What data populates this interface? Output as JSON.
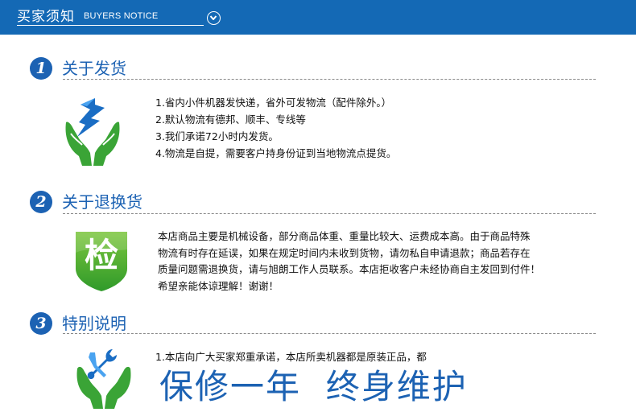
{
  "header": {
    "title_cn": "买家须知",
    "title_en": "BUYERS NOTICE"
  },
  "sections": [
    {
      "number": "1",
      "title": "关于发货",
      "icon": "hands-lightning-icon",
      "lines": [
        "1.省内小件机器发快递，省外可发物流（配件除外。）",
        "2.默认物流有德邦、顺丰、专线等",
        "3.我们承诺72小时内发货。",
        "4.物流是自提，需要客户持身份证到当地物流点提货。"
      ]
    },
    {
      "number": "2",
      "title": "关于退换货",
      "icon": "inspection-shield-icon",
      "icon_text": "检",
      "paragraph_lines": [
        "本店商品主要是机械设备，部分商品体重、重量比较大、运费成本高。由于商品特殊",
        "物流有时存在延误，如果在规定时间内未收到货物，请勿私自申请退款；商品若存在",
        "质量问题需退换货，请与旭朗工作人员联系。本店拒收客户未经协商自主发回到付件！",
        "希望亲能体谅理解！谢谢！"
      ]
    },
    {
      "number": "3",
      "title": "特别说明",
      "icon": "hands-wrench-icon",
      "lines": [
        "1.本店向广大买家郑重承诺，本店所卖机器都是原装正品，都"
      ],
      "slogan": "保修一年  终身维护"
    }
  ],
  "colors": {
    "header_bg": "#1469b5",
    "accent_blue": "#1c62b3",
    "green": "#3aa436"
  }
}
